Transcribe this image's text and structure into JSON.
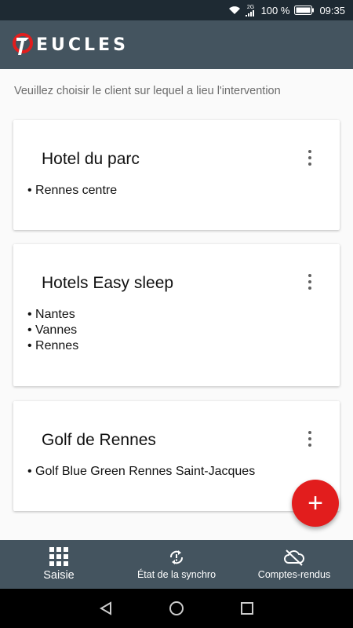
{
  "status_bar": {
    "battery": "100 %",
    "time": "09:35",
    "network": "2G"
  },
  "app_bar": {
    "logo_text": "EUCLES"
  },
  "instruction": "Veuillez choisir le client sur lequel a lieu l'intervention",
  "clients": [
    {
      "name": "Hotel du parc",
      "sites": [
        "Rennes centre"
      ]
    },
    {
      "name": "Hotels Easy sleep",
      "sites": [
        "Nantes",
        "Vannes",
        "Rennes"
      ]
    },
    {
      "name": "Golf de Rennes",
      "sites": [
        "Golf Blue Green Rennes Saint-Jacques"
      ]
    }
  ],
  "fab": {
    "label": "+"
  },
  "bottom_nav": {
    "items": [
      {
        "label": "Saisie",
        "icon": "grid-icon",
        "active": true
      },
      {
        "label": "État de la synchro",
        "icon": "sync-icon",
        "active": false
      },
      {
        "label": "Comptes-rendus",
        "icon": "cloud-off-icon",
        "active": false
      }
    ]
  },
  "colors": {
    "app_bar": "#44545f",
    "status_bar": "#1e2a33",
    "accent": "#e21d1d"
  }
}
